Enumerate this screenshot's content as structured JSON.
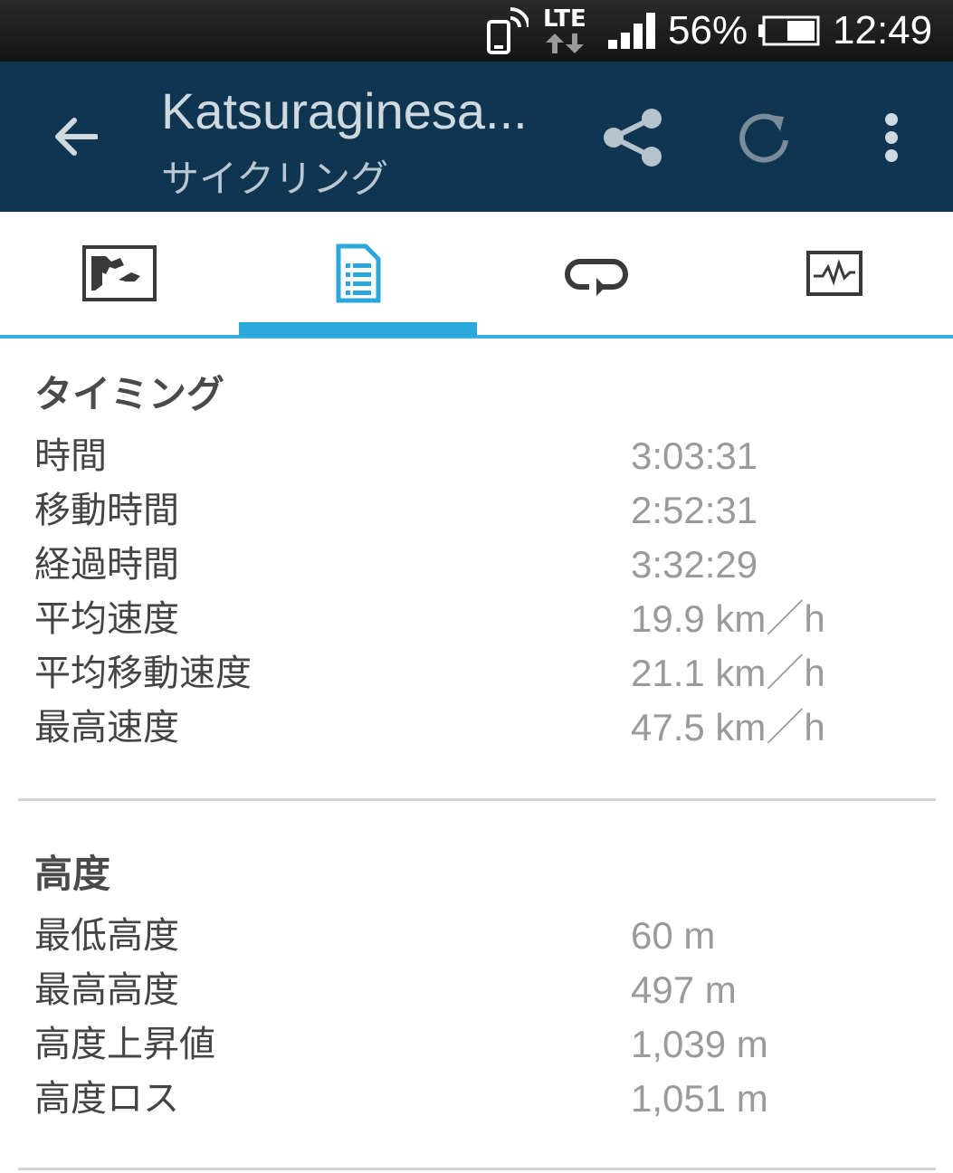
{
  "status_bar": {
    "network": "LTE",
    "battery_percent": "56%",
    "time": "12:49"
  },
  "app_bar": {
    "title": "Katsuraginesa...",
    "subtitle": "サイクリング"
  },
  "tabs": [
    {
      "icon": "map-icon",
      "selected": false
    },
    {
      "icon": "document-list-icon",
      "selected": true
    },
    {
      "icon": "loop-icon",
      "selected": false
    },
    {
      "icon": "graph-icon",
      "selected": false
    }
  ],
  "timing": {
    "title": "タイミング",
    "rows": [
      {
        "label": "時間",
        "value": "3:03:31"
      },
      {
        "label": "移動時間",
        "value": "2:52:31"
      },
      {
        "label": "経過時間",
        "value": "3:32:29"
      },
      {
        "label": "平均速度",
        "value": "19.9 km／h"
      },
      {
        "label": "平均移動速度",
        "value": "21.1 km／h"
      },
      {
        "label": "最高速度",
        "value": "47.5 km／h"
      }
    ]
  },
  "elevation": {
    "title": "高度",
    "rows": [
      {
        "label": "最低高度",
        "value": "60 m"
      },
      {
        "label": "最高高度",
        "value": "497 m"
      },
      {
        "label": "高度上昇値",
        "value": "1,039 m"
      },
      {
        "label": "高度ロス",
        "value": "1,051 m"
      }
    ]
  },
  "colors": {
    "app_bar": "#0f3550",
    "accent": "#2aa8dc",
    "status_bar": "#1a1a1a"
  }
}
